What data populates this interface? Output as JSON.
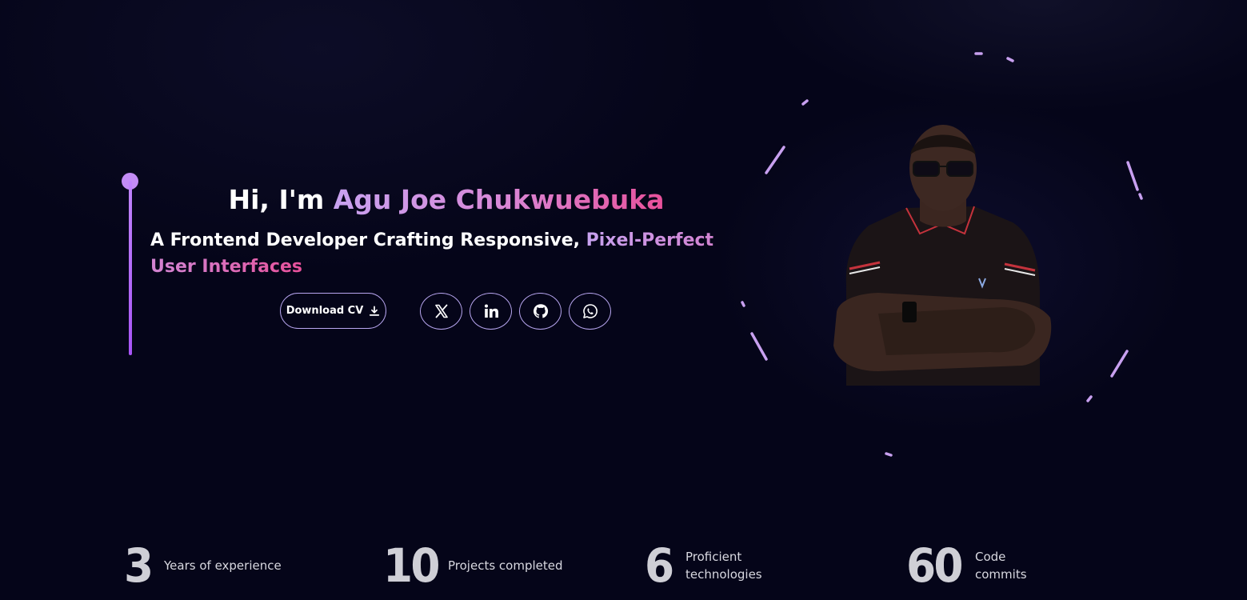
{
  "hero": {
    "greeting": "Hi, I'm ",
    "name": "Agu Joe Chukwuebuka",
    "subtitle_plain": "A Frontend Developer Crafting Responsive, ",
    "subtitle_highlight": "Pixel-Perfect User Interfaces",
    "download_label": "Download CV"
  },
  "social": [
    {
      "name": "x-icon"
    },
    {
      "name": "linkedin-icon"
    },
    {
      "name": "github-icon"
    },
    {
      "name": "whatsapp-icon"
    }
  ],
  "stats": [
    {
      "value": "3",
      "label": "Years of experience"
    },
    {
      "value": "10",
      "label": "Projects completed"
    },
    {
      "value": "6",
      "label": "Proficient\ntechnologies"
    },
    {
      "value": "60",
      "label": "Code\ncommits"
    }
  ],
  "colors": {
    "background": "#050519",
    "accent_purple": "#c084fc",
    "accent_pink": "#e8509a",
    "stat_number": "#cfcfd6"
  }
}
